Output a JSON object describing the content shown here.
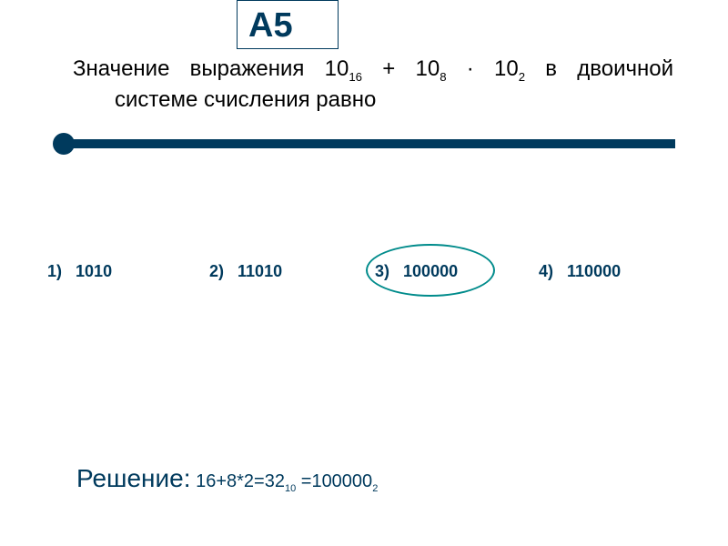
{
  "badge": "А5",
  "question": {
    "line1_parts": {
      "a": "Значение выражения 10",
      "sub1": "16",
      "b": " + 10",
      "sub2": "8",
      "c": " · 10",
      "sub3": "2",
      "d": " в двоичной"
    },
    "line2": "системе счисления равно"
  },
  "options": {
    "o1": {
      "num": "1)",
      "val": "1010"
    },
    "o2": {
      "num": "2)",
      "val": "11010"
    },
    "o3": {
      "num": "3)",
      "val": "100000"
    },
    "o4": {
      "num": "4)",
      "val": "110000"
    }
  },
  "correct_option": 3,
  "solution": {
    "label": "Решение:",
    "expr_parts": {
      "a": " 16+8*2=32",
      "sub1": "10",
      "b": " =100000",
      "sub2": "2"
    }
  }
}
